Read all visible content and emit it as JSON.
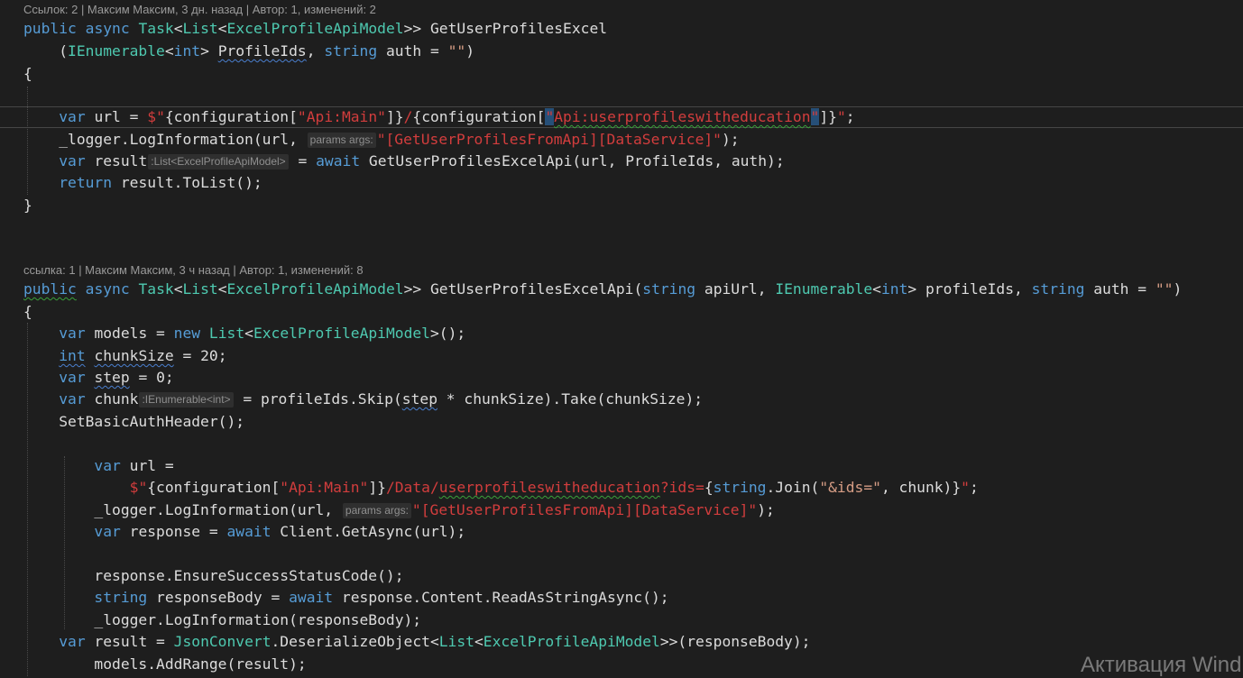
{
  "codelens": [
    "Ссылок: 2 | Максим Максим, 3 дн. назад | Автор: 1, изменений: 2",
    "ссылка: 1 | Максим Максим, 3 ч назад | Автор: 1, изменений: 8"
  ],
  "code": {
    "l01": [
      "public",
      " ",
      "async",
      " ",
      "Task",
      "<",
      "List",
      "<",
      "ExcelProfileApiModel",
      ">> ",
      "GetUserProfilesExcel"
    ],
    "l02": [
      "    (",
      "IEnumerable",
      "<",
      "int",
      "> ",
      "ProfileIds",
      ", ",
      "string",
      " auth = ",
      "\"\"",
      ")"
    ],
    "l03": [
      "{"
    ],
    "l05": [
      "    ",
      "var",
      " url = ",
      "$\"",
      "{configuration[",
      "\"",
      "Api:Main",
      "\"",
      "]}",
      "/",
      "{configuration[",
      "\"",
      "Api:userprofileswitheducation",
      "\"",
      "]}",
      "\"",
      ";"
    ],
    "l06": [
      "    _logger.LogInformation(url, ",
      "params args:",
      "\"[GetUserProfilesFromApi][DataService]\"",
      ");"
    ],
    "l07": [
      "    ",
      "var",
      " result",
      ":List<ExcelProfileApiModel>",
      " = ",
      "await",
      " GetUserProfilesExcelApi(url, ProfileIds, auth);"
    ],
    "l08": [
      "    ",
      "return",
      " result.ToList();"
    ],
    "l09": [
      "}"
    ],
    "l13": [
      "public",
      " ",
      "async",
      " ",
      "Task",
      "<",
      "List",
      "<",
      "ExcelProfileApiModel",
      ">> ",
      "GetUserProfilesExcelApi(",
      "string",
      " apiUrl, ",
      "IEnumerable",
      "<",
      "int",
      "> profileIds, ",
      "string",
      " auth = ",
      "\"\"",
      ")"
    ],
    "l14": [
      "{"
    ],
    "l15": [
      "    ",
      "var",
      " models = ",
      "new",
      " ",
      "List",
      "<",
      "ExcelProfileApiModel",
      ">();"
    ],
    "l16": [
      "    ",
      "int",
      " ",
      "chunkSize",
      " = 20;"
    ],
    "l17": [
      "    ",
      "var",
      " ",
      "step",
      " = 0;"
    ],
    "l18": [
      "    ",
      "var",
      " chunk",
      ":IEnumerable<int>",
      " = profileIds.Skip(",
      "step",
      " * chunkSize).Take(chunkSize);"
    ],
    "l19": [
      "    SetBasicAuthHeader();"
    ],
    "l21": [
      "        ",
      "var",
      " url ="
    ],
    "l22": [
      "            ",
      "$\"",
      "{configuration[",
      "\"Api:Main\"",
      "]}",
      "/Data/",
      "userprofileswitheducation",
      "?ids=",
      "{",
      "string",
      ".Join(",
      "\"&ids=\"",
      ", chunk)}",
      "\"",
      ";"
    ],
    "l23": [
      "        _logger.LogInformation(url, ",
      "params args:",
      "\"[GetUserProfilesFromApi][DataService]\"",
      ");"
    ],
    "l24": [
      "        ",
      "var",
      " response = ",
      "await",
      " Client.GetAsync(url);"
    ],
    "l26": [
      "        response.EnsureSuccessStatusCode();"
    ],
    "l27": [
      "        ",
      "string",
      " responseBody = ",
      "await",
      " response.Content.ReadAsStringAsync();"
    ],
    "l28": [
      "        _logger.LogInformation(responseBody);"
    ],
    "l29": [
      "    ",
      "var",
      " result = ",
      "JsonConvert",
      ".DeserializeObject<",
      "List",
      "<",
      "ExcelProfileApiModel",
      ">>(responseBody);"
    ],
    "l30": [
      "        models.AddRange(result);"
    ]
  },
  "watermark": "Активация Wind",
  "colors": {
    "background": "#1e1e1e",
    "keyword": "#569cd6",
    "type": "#4ec9b0",
    "string": "#d69d85",
    "interpolated_string": "#d23d3d",
    "text": "#dcdcdc",
    "codelens": "#9a9a9a"
  }
}
